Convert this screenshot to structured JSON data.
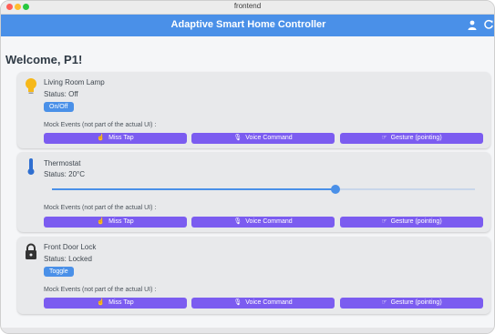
{
  "window": {
    "title": "frontend"
  },
  "appbar": {
    "title": "Adaptive Smart Home Controller"
  },
  "welcome": "Welcome, P1!",
  "devices": [
    {
      "name": "Living Room Lamp",
      "status": "Status: Off",
      "control_label": "On/Off",
      "icon": "lightbulb-icon"
    },
    {
      "name": "Thermostat",
      "status": "Status: 20°C",
      "icon": "thermometer-icon",
      "slider_value": 0.67
    },
    {
      "name": "Front Door Lock",
      "status": "Status: Locked",
      "control_label": "Toggle",
      "icon": "lock-icon"
    }
  ],
  "mock": {
    "label": "Mock Events (not part of the actual UI) :",
    "miss_tap": "Miss Tap",
    "voice_command": "Voice Command",
    "gesture": "Gesture (pointing)"
  },
  "colors": {
    "primary": "#4a90e8",
    "mock_button": "#7b5cf0",
    "bulb": "#f6b81a",
    "thermometer": "#2f6fd0",
    "lock": "#333333"
  }
}
